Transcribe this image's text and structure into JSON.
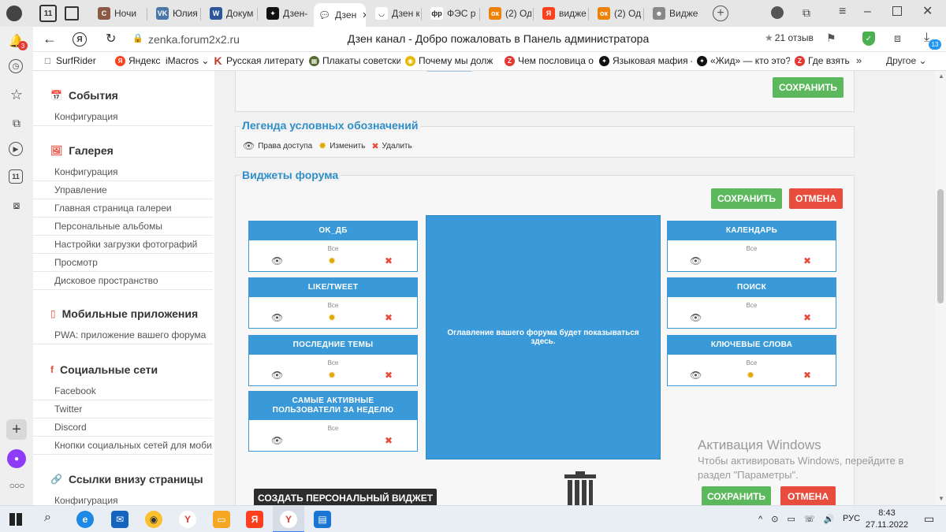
{
  "tabs": [
    {
      "label": "Ночи",
      "fav": "С",
      "color": "#8a5a44"
    },
    {
      "label": "Юлия",
      "fav": "VK",
      "color": "#4a76a8"
    },
    {
      "label": "Докум",
      "fav": "W",
      "color": "#2b579a"
    },
    {
      "label": "Дзен-",
      "fav": "✦",
      "color": "#111111"
    },
    {
      "label": "Дзен",
      "fav": "💬",
      "color": "#ffffff"
    },
    {
      "label": "Дзен к",
      "fav": "◡",
      "color": "#ffffff"
    },
    {
      "label": "ФЭС р",
      "fav": "фр",
      "color": "#ffffff"
    },
    {
      "label": "(2) Од",
      "fav": "ок",
      "color": "#ee8208"
    },
    {
      "label": "видже",
      "fav": "Я",
      "color": "#fc3f1d"
    },
    {
      "label": "(2) Од",
      "fav": "ок",
      "color": "#ee8208"
    },
    {
      "label": "Видже",
      "fav": "☻",
      "color": "#888888"
    }
  ],
  "address": {
    "url": "zenka.forum2x2.ru",
    "page_title": "Дзен канал - Добро пожаловать в Панель администратора",
    "reviews": "21 отзыв"
  },
  "badges": {
    "notifications": "3",
    "downloads": "13",
    "tab_count": "11",
    "left_tabs": "11"
  },
  "bookmarks": [
    {
      "label": "SurfRider",
      "icon": "□",
      "color": "#666666"
    },
    {
      "label": "Яндекс",
      "icon": "Я",
      "color": "#fc3f1d"
    },
    {
      "label": "iMacros ⌄",
      "icon": "",
      "color": "#ffffff"
    },
    {
      "label": "Русская литератур",
      "icon": "K",
      "color": "#c0392b"
    },
    {
      "label": "Плакаты советски",
      "icon": "▦",
      "color": "#556b2f"
    },
    {
      "label": "Почему мы долж",
      "icon": "◉",
      "color": "#e6b800"
    },
    {
      "label": "Чем пословица о",
      "icon": "Z",
      "color": "#e53935"
    },
    {
      "label": "Языковая мафия -",
      "icon": "✦",
      "color": "#111111"
    },
    {
      "label": "«Жид» — кто это?",
      "icon": "✦",
      "color": "#111111"
    },
    {
      "label": "Где взять",
      "icon": "Z",
      "color": "#e53935"
    }
  ],
  "bookmarks_more": "»",
  "bookmarks_other": "Другое ⌄",
  "sidebar": {
    "sections": [
      {
        "title": "События",
        "icon": "📅",
        "items": [
          "Конфигурация"
        ]
      },
      {
        "title": "Галерея",
        "icon": "🖼",
        "items": [
          "Конфигурация",
          "Управление",
          "Главная страница галереи",
          "Персональные альбомы",
          "Настройки загрузки фотографий",
          "Просмотр",
          "Дисковое пространство"
        ]
      },
      {
        "title": "Мобильные приложения",
        "icon": "▯",
        "items": [
          "PWA: приложение вашего форума"
        ]
      },
      {
        "title": "Социальные сети",
        "icon": "f",
        "items": [
          "Facebook",
          "Twitter",
          "Discord",
          "Кнопки социальных сетей для моби..."
        ]
      },
      {
        "title": "Ссылки внизу страницы",
        "icon": "🔗",
        "items": [
          "Конфигурация"
        ]
      }
    ]
  },
  "main": {
    "save_label": "СОХРАНИТЬ",
    "cancel_label": "ОТМЕНА",
    "legend_title": "Легенда условных обозначений",
    "legend": {
      "access": "Права доступа",
      "edit": "Изменить",
      "delete": "Удалить"
    },
    "widgets_title": "Виджеты форума",
    "center_text": "Оглавление вашего форума будет показываться здесь.",
    "create_widget": "СОЗДАТЬ ПЕРСОНАЛЬНЫЙ ВИДЖЕТ",
    "left_widgets": [
      {
        "title": "OK_ДБ",
        "sub": "Все",
        "edit": true
      },
      {
        "title": "LIKE/TWEET",
        "sub": "Все",
        "edit": true
      },
      {
        "title": "ПОСЛЕДНИЕ ТЕМЫ",
        "sub": "Все",
        "edit": true
      },
      {
        "title": "САМЫЕ АКТИВНЫЕ ПОЛЬЗОВАТЕЛИ ЗА НЕДЕЛЮ",
        "sub": "Все",
        "edit": false
      }
    ],
    "right_widgets": [
      {
        "title": "КАЛЕНДАРЬ",
        "sub": "Все",
        "edit": false
      },
      {
        "title": "ПОИСК",
        "sub": "Все",
        "edit": false
      },
      {
        "title": "КЛЮЧЕВЫЕ СЛОВА",
        "sub": "Все",
        "edit": true
      }
    ]
  },
  "watermark": {
    "title": "Активация Windows",
    "line1": "Чтобы активировать Windows, перейдите в",
    "line2": "раздел \"Параметры\"."
  },
  "taskbar": {
    "lang": "РУС",
    "time": "8:43",
    "date": "27.11.2022"
  },
  "colors": {
    "accent": "#3a9ad9",
    "save": "#5cb85c",
    "cancel": "#e74c3c",
    "title": "#2f8fc9"
  }
}
